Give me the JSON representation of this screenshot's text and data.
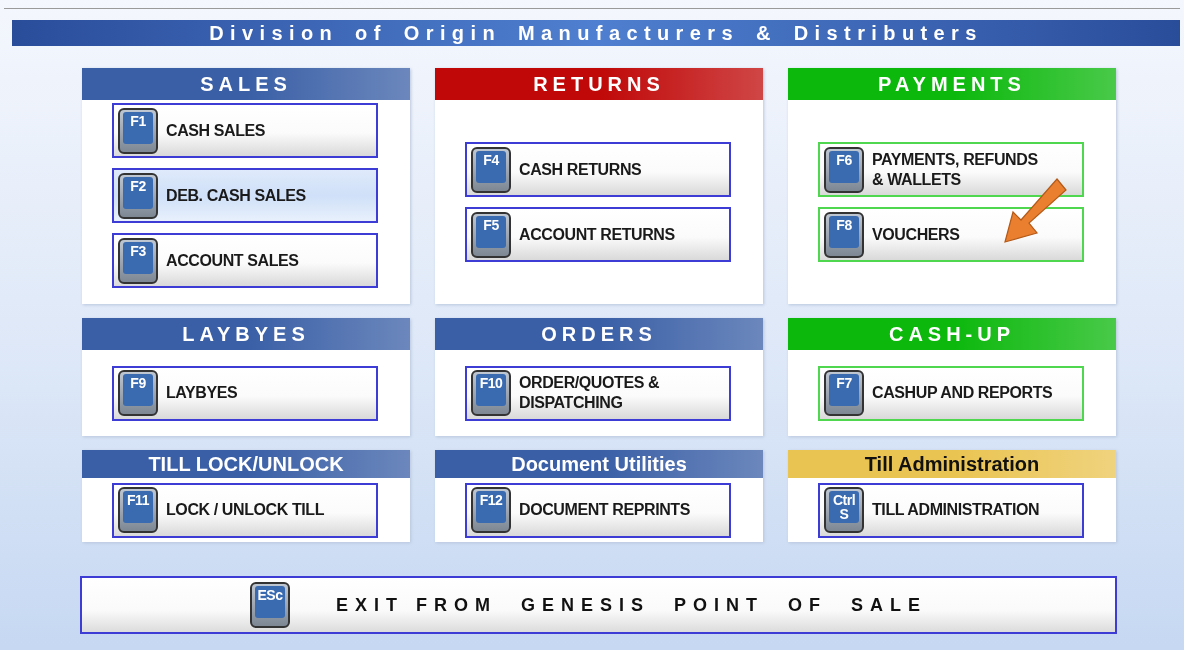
{
  "title": "Division of Origin Manufacturers & Distributers",
  "panels": [
    {
      "heading": "SALES",
      "spaced": true,
      "color": "#3a5fa6",
      "pointer": false,
      "buttons": [
        {
          "key": "F1",
          "label": "CASH SALES",
          "selected": false,
          "color": "#3d3dd6"
        },
        {
          "key": "F2",
          "label": "DEB. CASH SALES",
          "selected": true,
          "color": "#3d3dd6"
        },
        {
          "key": "F3",
          "label": "ACCOUNT SALES",
          "selected": false,
          "color": "#3d3dd6"
        }
      ]
    },
    {
      "heading": "RETURNS",
      "spaced": true,
      "color": "#c00808",
      "pointer": false,
      "buttons": [
        {
          "key": "F4",
          "label": "CASH  RETURNS",
          "selected": false,
          "color": "#3d3dd6"
        },
        {
          "key": "F5",
          "label": "ACCOUNT RETURNS",
          "selected": false,
          "color": "#3d3dd6"
        }
      ]
    },
    {
      "heading": "PAYMENTS",
      "spaced": true,
      "color": "#0cb80c",
      "pointer": true,
      "buttons": [
        {
          "key": "F6",
          "label": "PAYMENTS, REFUNDS\n& WALLETS",
          "selected": false,
          "color": "#4fd84f"
        },
        {
          "key": "F8",
          "label": "VOUCHERS",
          "selected": false,
          "color": "#4fd84f"
        }
      ]
    },
    {
      "heading": "LAYBYES",
      "spaced": true,
      "color": "#3a5fa6",
      "pointer": false,
      "buttons": [
        {
          "key": "F9",
          "label": " LAYBYES",
          "selected": false,
          "color": "#3d3dd6"
        }
      ]
    },
    {
      "heading": "ORDERS",
      "spaced": true,
      "color": "#3a5fa6",
      "pointer": false,
      "buttons": [
        {
          "key": "F10",
          "label": "ORDER/QUOTES &\nDISPATCHING",
          "selected": false,
          "color": "#3d3dd6"
        }
      ]
    },
    {
      "heading": "CASH-UP",
      "spaced": true,
      "color": "#0cb80c",
      "pointer": false,
      "buttons": [
        {
          "key": "F7",
          "label": "CASHUP AND REPORTS",
          "selected": false,
          "color": "#4fd84f"
        }
      ]
    },
    {
      "heading": "TILL LOCK/UNLOCK",
      "spaced": false,
      "color": "#3a5fa6",
      "pointer": false,
      "buttons": [
        {
          "key": "F11",
          "label": "LOCK / UNLOCK TILL",
          "selected": false,
          "color": "#3d3dd6"
        }
      ]
    },
    {
      "heading": "Document Utilities",
      "spaced": false,
      "color": "#3a5fa6",
      "pointer": false,
      "buttons": [
        {
          "key": "F12",
          "label": "DOCUMENT REPRINTS",
          "selected": false,
          "color": "#3d3dd6"
        }
      ]
    },
    {
      "heading": "Till Administration",
      "spaced": false,
      "color": "#eac452",
      "pointer": false,
      "buttons": [
        {
          "key": "Ctrl S",
          "label": "TILL ADMINISTRATION",
          "selected": false,
          "color": "#3d3dd6"
        }
      ]
    }
  ],
  "exit": {
    "key": "ESc",
    "label": "EXIT FROM  GENESIS  POINT  OF  SALE"
  }
}
